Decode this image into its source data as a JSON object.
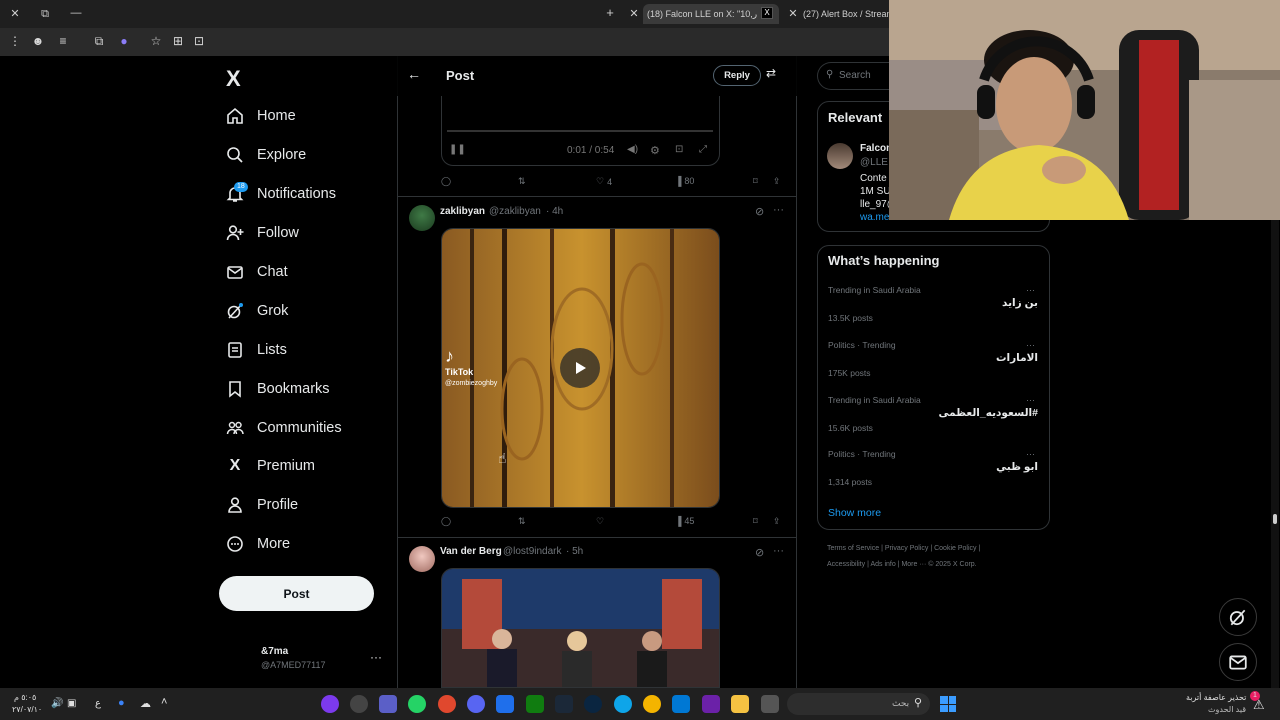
{
  "browser": {
    "tabs": [
      {
        "label": "(18) Falcon LLE on X: \"10,ر",
        "active": true
      },
      {
        "label": "(27) Alert Box / Streamla",
        "active": false
      }
    ],
    "new_tab": "+",
    "close": "✕"
  },
  "nav": {
    "logo": "X",
    "items": [
      {
        "label": "Home",
        "icon": "home-icon"
      },
      {
        "label": "Explore",
        "icon": "search-icon"
      },
      {
        "label": "Notifications",
        "icon": "bell-icon"
      },
      {
        "label": "Follow",
        "icon": "person-plus-icon"
      },
      {
        "label": "Chat",
        "icon": "envelope-icon"
      },
      {
        "label": "Grok",
        "icon": "grok-icon"
      },
      {
        "label": "Lists",
        "icon": "list-icon"
      },
      {
        "label": "Bookmarks",
        "icon": "bookmark-icon"
      },
      {
        "label": "Communities",
        "icon": "communities-icon"
      },
      {
        "label": "Premium",
        "icon": "x-icon"
      },
      {
        "label": "Profile",
        "icon": "person-icon"
      },
      {
        "label": "More",
        "icon": "more-circle-icon"
      }
    ],
    "notifications_badge": "18",
    "post_button": "Post",
    "account": {
      "name": "&7ma",
      "handle": "@A7MED77117",
      "more": "···"
    }
  },
  "header": {
    "title": "Post",
    "reply_button": "Reply"
  },
  "player": {
    "time": "0:01 / 0:54"
  },
  "actions_top": {
    "likes": "4",
    "views": "80"
  },
  "tweets": [
    {
      "name": "zaklibyan",
      "handle": "@zaklibyan",
      "time": "· 4h",
      "tiktok": "TikTok",
      "tiktok_handle": "@zombiezoghby",
      "views": "45"
    },
    {
      "name": "Van der Berg",
      "handle": "@lost9indark",
      "time": "· 5h"
    }
  ],
  "sidebar": {
    "search_placeholder": "Search",
    "relevant_title": "Relevant",
    "relevant_user": {
      "name": "Falcon",
      "handle": "@LLE",
      "lines": [
        "Conte",
        "1M SU",
        "lle_97@",
        "wa.me/"
      ]
    },
    "happening_title": "What’s happening",
    "trends": [
      {
        "context": "Trending in Saudi Arabia",
        "name": "بن زايد",
        "count": "13.5K posts"
      },
      {
        "context": "Politics · Trending",
        "name": "الامارات",
        "count": "175K posts"
      },
      {
        "context": "Trending in Saudi Arabia",
        "name": "#السعوديه_العظمى",
        "count": "15.6K posts"
      },
      {
        "context": "Politics · Trending",
        "name": "ابو ظبي",
        "count": "1,314 posts"
      }
    ],
    "show_more": "Show more",
    "footer_line1": "Terms of Service  |  Privacy Policy  |  Cookie Policy  |",
    "footer_line2": "Accessibility  |  Ads info  |  More ···  © 2025 X Corp."
  },
  "taskbar": {
    "time": "٥:٠٥ م",
    "date": "٢٧/٠٧/١٠",
    "lang": "ع",
    "search_placeholder": "بحث",
    "news_line1": "تحذير عاصفة أتربة",
    "news_line2": "قيد الحدوث",
    "news_badge": "1"
  }
}
